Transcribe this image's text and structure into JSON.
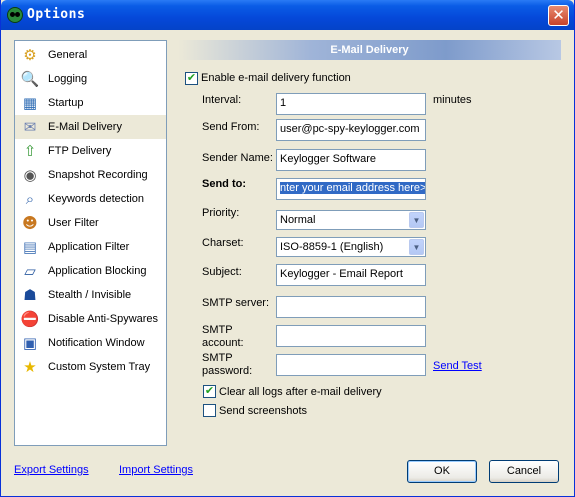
{
  "window": {
    "title": "Options",
    "close": "✕"
  },
  "nav": {
    "items": [
      {
        "label": "General",
        "icon": "gear-icon",
        "glyph": "⚙",
        "color": "#d8a020"
      },
      {
        "label": "Logging",
        "icon": "magnifier-log-icon",
        "glyph": "🔍",
        "color": "#4a6fa5"
      },
      {
        "label": "Startup",
        "icon": "startup-icon",
        "glyph": "▦",
        "color": "#2f6db5"
      },
      {
        "label": "E-Mail Delivery",
        "icon": "envelope-icon",
        "glyph": "✉",
        "color": "#6a7fb0"
      },
      {
        "label": "FTP Delivery",
        "icon": "up-arrow-icon",
        "glyph": "⇧",
        "color": "#3a9a3a"
      },
      {
        "label": "Snapshot Recording",
        "icon": "camera-icon",
        "glyph": "◉",
        "color": "#555555"
      },
      {
        "label": "Keywords detection",
        "icon": "search-icon",
        "glyph": "⌕",
        "color": "#3c6cb0"
      },
      {
        "label": "User Filter",
        "icon": "users-icon",
        "glyph": "☻",
        "color": "#c87820"
      },
      {
        "label": "Application Filter",
        "icon": "app-filter-icon",
        "glyph": "▤",
        "color": "#4a78b8"
      },
      {
        "label": "Application Blocking",
        "icon": "app-block-icon",
        "glyph": "▱",
        "color": "#2a5aa0"
      },
      {
        "label": "Stealth / Invisible",
        "icon": "stealth-icon",
        "glyph": "☗",
        "color": "#1a4a9a"
      },
      {
        "label": "Disable Anti-Spywares",
        "icon": "shield-block-icon",
        "glyph": "⛔",
        "color": "#c82020"
      },
      {
        "label": "Notification Window",
        "icon": "notification-window-icon",
        "glyph": "▣",
        "color": "#3060b0"
      },
      {
        "label": "Custom System Tray",
        "icon": "star-icon",
        "glyph": "★",
        "color": "#e8b800"
      }
    ],
    "selected_index": 3
  },
  "panel": {
    "header": "E-Mail Delivery",
    "enable_label": "Enable e-mail delivery function",
    "enable_checked": true,
    "interval_label": "Interval:",
    "interval_value": "1",
    "interval_unit": "minutes",
    "from_label": "Send From:",
    "from_value": "user@pc-spy-keylogger.com",
    "sender_label": "Sender Name:",
    "sender_value": "Keylogger Software",
    "to_label": "Send to:",
    "to_value": "nter your email address here>",
    "priority_label": "Priority:",
    "priority_value": "Normal",
    "charset_label": "Charset:",
    "charset_value": "ISO-8859-1 (English)",
    "subject_label": "Subject:",
    "subject_value": "Keylogger - Email Report",
    "smtp_server_label": "SMTP server:",
    "smtp_server_value": "",
    "smtp_account_label": "SMTP\naccount:",
    "smtp_account_value": "",
    "smtp_password_label": "SMTP\npassword:",
    "smtp_password_value": "",
    "send_test": "Send Test",
    "clear_logs_label": "Clear all logs after e-mail delivery",
    "clear_logs_checked": true,
    "screenshots_label": "Send screenshots",
    "screenshots_checked": false
  },
  "footer": {
    "export": "Export Settings",
    "import": "Import Settings",
    "ok": "OK",
    "cancel": "Cancel"
  }
}
